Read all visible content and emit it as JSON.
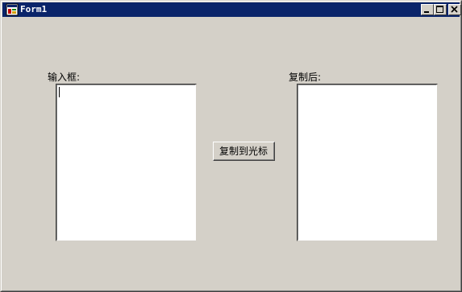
{
  "window": {
    "title": "Form1",
    "colors": {
      "titlebar": "#0a246a",
      "face": "#d4d0c8"
    },
    "controls": {
      "minimize_icon": "minimize-icon",
      "maximize_icon": "maximize-icon",
      "close_icon": "close-icon"
    }
  },
  "form": {
    "input_label": "输入框:",
    "input_value": "",
    "output_label": "复制后:",
    "output_value": "",
    "copy_button_label": "复制到光标"
  }
}
